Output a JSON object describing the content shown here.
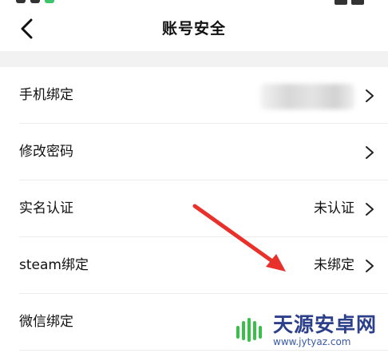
{
  "header": {
    "title": "账号安全",
    "back_icon": "chevron-left-icon"
  },
  "rows": [
    {
      "label": "手机绑定",
      "value": "",
      "value_blurred": true
    },
    {
      "label": "修改密码",
      "value": "",
      "value_blurred": false
    },
    {
      "label": "实名认证",
      "value": "未认证",
      "value_blurred": false
    },
    {
      "label": "steam绑定",
      "value": "未绑定",
      "value_blurred": false
    },
    {
      "label": "微信绑定",
      "value": "",
      "value_blurred": false
    }
  ],
  "annotation": {
    "color": "#e8312a"
  },
  "watermark": {
    "title": "天源安卓网",
    "url": "www.jytyaz.com",
    "logo_color": "#3cbf4a"
  }
}
